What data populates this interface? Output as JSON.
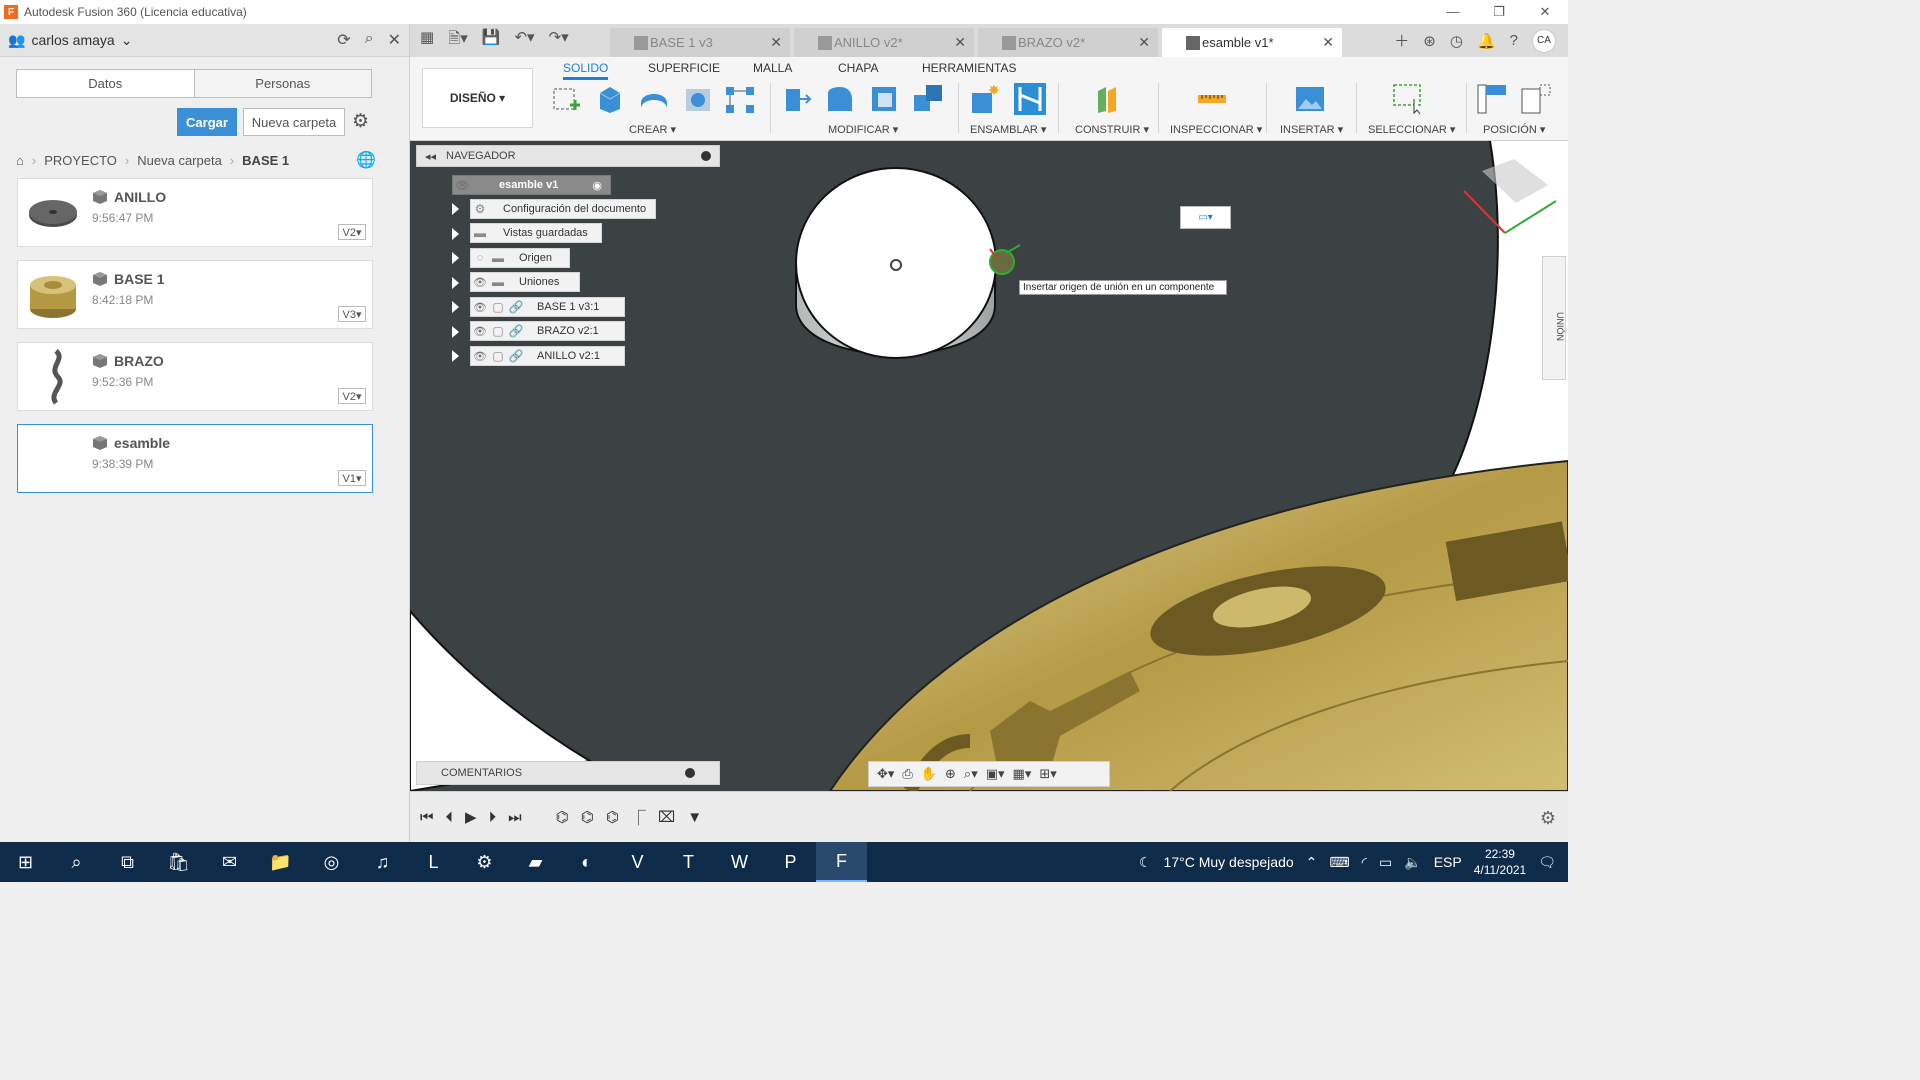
{
  "window": {
    "title": "Autodesk Fusion 360 (Licencia educativa)",
    "logo": "F",
    "controls": [
      "—",
      "❐",
      "✕"
    ]
  },
  "datapanel": {
    "user": "carlos amaya",
    "tabs": [
      "Datos",
      "Personas"
    ],
    "upload_label": "Cargar",
    "new_folder_label": "Nueva carpeta",
    "breadcrumb": [
      "PROYECTO",
      "Nueva carpeta",
      "BASE 1"
    ],
    "files": [
      {
        "name": "ANILLO",
        "time": "9:56:47 PM",
        "version": "V2▾"
      },
      {
        "name": "BASE 1",
        "time": "8:42:18 PM",
        "version": "V3▾"
      },
      {
        "name": "BRAZO",
        "time": "9:52:36 PM",
        "version": "V2▾"
      },
      {
        "name": "esamble",
        "time": "9:38:39 PM",
        "version": "V1▾"
      }
    ]
  },
  "doc_tabs": [
    {
      "label": "BASE 1 v3",
      "active": false
    },
    {
      "label": "ANILLO v2*",
      "active": false
    },
    {
      "label": "BRAZO v2*",
      "active": false
    },
    {
      "label": "esamble v1*",
      "active": true
    }
  ],
  "user_initials": "CA",
  "ribbon": {
    "workspace": "DISEÑO ▾",
    "tabs": [
      "SOLIDO",
      "SUPERFICIE",
      "MALLA",
      "CHAPA",
      "HERRAMIENTAS"
    ],
    "groups": [
      "CREAR ▾",
      "MODIFICAR ▾",
      "ENSAMBLAR ▾",
      "CONSTRUIR ▾",
      "INSPECCIONAR ▾",
      "INSERTAR ▾",
      "SELECCIONAR ▾",
      "POSICIÓN ▾"
    ]
  },
  "navigator": {
    "title": "NAVEGADOR",
    "root": "esamble v1",
    "items": [
      "Configuración del documento",
      "Vistas guardadas",
      "Origen",
      "Uniones",
      "BASE 1 v3:1",
      "BRAZO v2:1",
      "ANILLO v2:1"
    ]
  },
  "comments_label": "COMENTARIOS",
  "tooltip": "Insertar origen de unión en un componente",
  "side_panel_label": "UNIÓN",
  "taskbar": {
    "weather": "17°C  Muy despejado",
    "language": "ESP",
    "time": "22:39",
    "date": "4/11/2021"
  }
}
